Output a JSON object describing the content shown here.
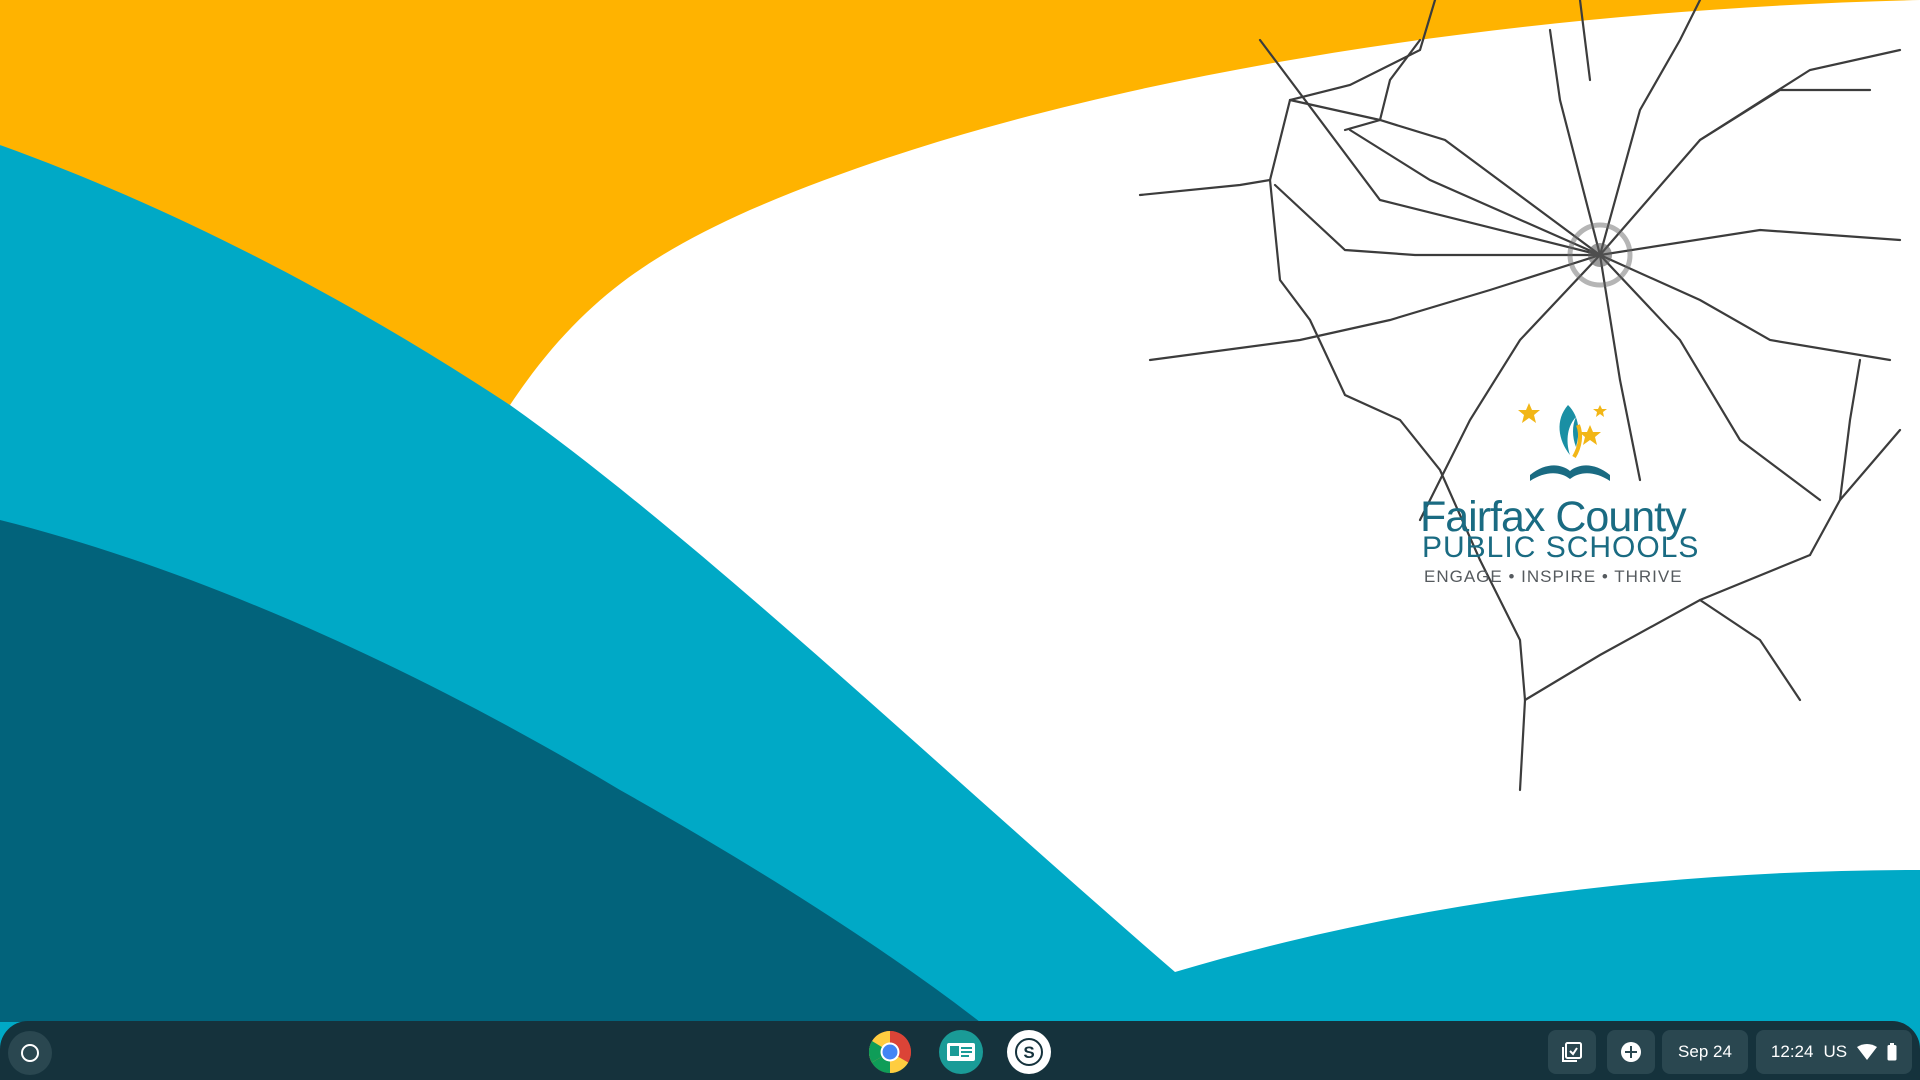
{
  "wallpaper": {
    "colors": {
      "orange": "#ffb300",
      "light_blue": "#00a9c6",
      "dark_blue": "#02637b",
      "white": "#ffffff"
    },
    "logo": {
      "line1": "Fairfax County",
      "line2": "PUBLIC SCHOOLS",
      "line3": "ENGAGE • INSPIRE • THRIVE",
      "star_color": "#f2b616",
      "flame_color": "#1a8fa4"
    }
  },
  "shelf": {
    "launcher_icon": "launcher-circle-icon",
    "pinned_apps": [
      {
        "name": "Google Chrome",
        "icon": "chrome-icon"
      },
      {
        "name": "Classroom app",
        "icon": "classroom-card-icon"
      },
      {
        "name": "Securly",
        "icon": "securly-s-icon"
      }
    ],
    "tray": {
      "holding_space_icon": "holding-space-icon",
      "add_icon": "add-circle-icon",
      "date": "Sep 24",
      "time": "12:24",
      "ime": "US",
      "wifi_icon": "wifi-icon",
      "battery_icon": "battery-icon"
    }
  }
}
